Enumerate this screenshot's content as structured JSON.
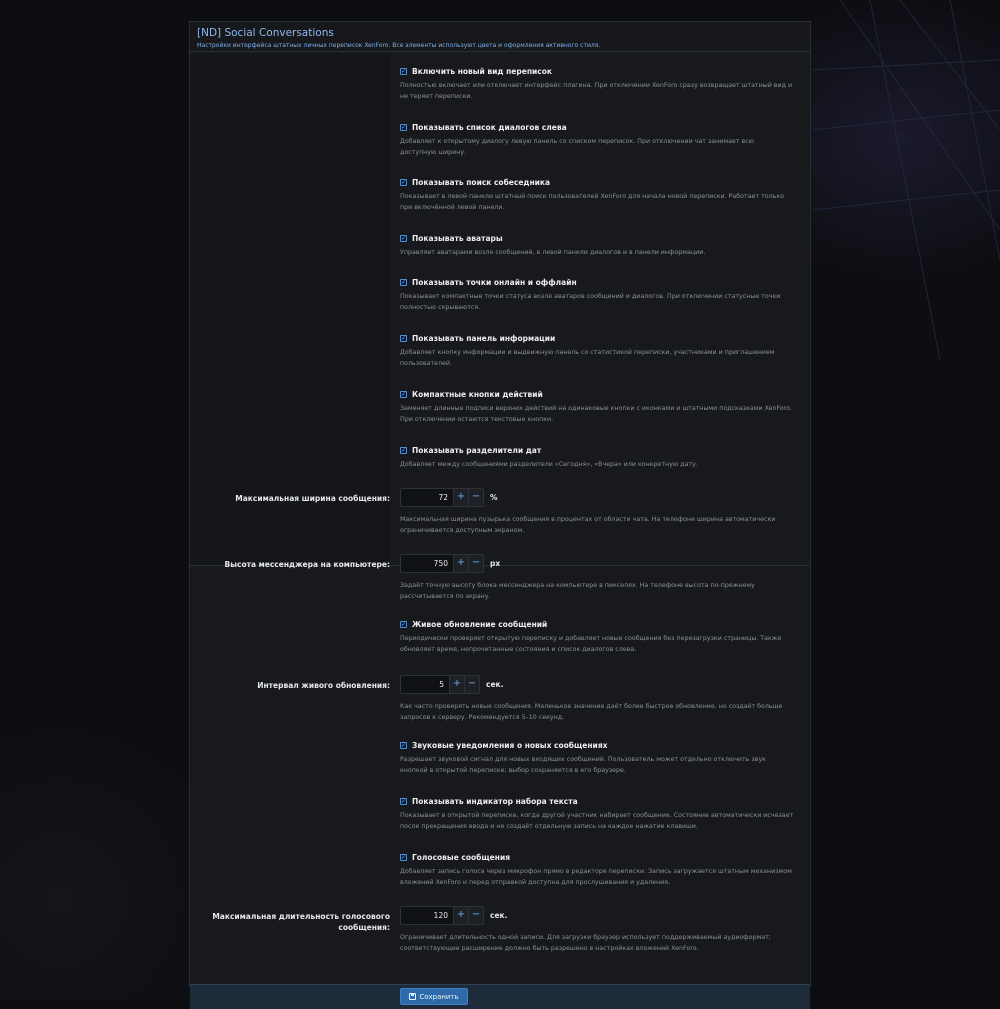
{
  "panel": {
    "title": "[ND] Social Conversations",
    "description": "Настройки интерфейса штатных личных переписок XenForo. Все элементы используют цвета и оформления активного стиля."
  },
  "options": [
    {
      "label": "Включить новый вид переписок",
      "checked": true,
      "help": [
        "Полностью включает или отключает интерфейс плагина. При отключении XenForo сразу возвращает штатный вид и",
        "не теряет переписки."
      ]
    },
    {
      "label": "Показывать список диалогов слева",
      "checked": true,
      "help": [
        "Добавляет к открытому диалогу левую панель со списком переписок. При отключении чат занимает всю",
        "доступную ширину."
      ]
    },
    {
      "label": "Показывать поиск собеседника",
      "checked": true,
      "help": [
        "Показывает в левой панели штатный поиск пользователей XenForo для начала новой переписки. Работает только",
        "при включённой левой панели."
      ]
    },
    {
      "label": "Показывать аватары",
      "checked": true,
      "help": [
        "Управляет аватарами возле сообщений, в левой панели диалогов и в панели информации."
      ]
    },
    {
      "label": "Показывать точки онлайн и оффлайн",
      "checked": true,
      "help": [
        "Показывает компактные точки статуса возле аватаров сообщений и диалогов. При отключении статусные точки",
        "полностью скрываются."
      ]
    },
    {
      "label": "Показывать панель информации",
      "checked": true,
      "help": [
        "Добавляет кнопку информации и выдвижную панель со статистикой переписки, участниками и приглашением",
        "пользователей."
      ]
    },
    {
      "label": "Компактные кнопки действий",
      "checked": true,
      "help": [
        "Заменяет длинные подписи верхних действий на одинаковые кнопки с иконками и штатными подсказками XenForo.",
        "При отключении остаются текстовые кнопки."
      ]
    },
    {
      "label": "Показывать разделители дат",
      "checked": true,
      "help": [
        "Добавляет между сообщениями разделители «Сегодня», «Вчера» или конкретную дату."
      ]
    }
  ],
  "max_width": {
    "label": "Максимальная ширина сообщения:",
    "value": "72",
    "unit": "%",
    "help": [
      "Максимальная ширина пузырька сообщения в процентах от области чата. На телефоне ширина автоматически",
      "ограничивается доступным экраном."
    ]
  },
  "desktop_height": {
    "label": "Высота мессенджера на компьютере:",
    "value": "750",
    "unit": "px",
    "help": [
      "Задаёт точную высоту блока мессенджера на компьютере в пикселях. На телефоне высота по-прежнему",
      "рассчитывается по экрану."
    ]
  },
  "live_update": {
    "label": "Живое обновление сообщений",
    "checked": true,
    "help": [
      "Периодически проверяет открытую переписку и добавляет новые сообщения без перезагрузки страницы. Также",
      "обновляет время, непрочитанные состояния и список диалогов слева."
    ]
  },
  "live_interval": {
    "label": "Интервал живого обновления:",
    "value": "5",
    "unit": "сек.",
    "help": [
      "Как часто проверять новые сообщения. Маленькое значение даёт более быстрое обновление, но создаёт больше",
      "запросов к серверу. Рекомендуется 5–10 секунд."
    ]
  },
  "sound_notify": {
    "label": "Звуковые уведомления о новых сообщениях",
    "checked": true,
    "help": [
      "Разрешает звуковой сигнал для новых входящих сообщений. Пользователь может отдельно отключить звук",
      "кнопкой в открытой переписке; выбор сохраняется в его браузере."
    ]
  },
  "typing_indicator": {
    "label": "Показывать индикатор набора текста",
    "checked": true,
    "help": [
      "Показывает в открытой переписке, когда другой участник набирает сообщение. Состояние автоматически исчезает",
      "после прекращения ввода и не создаёт отдельную запись на каждое нажатие клавиши."
    ]
  },
  "voice_messages": {
    "label": "Голосовые сообщения",
    "checked": true,
    "help": [
      "Добавляет запись голоса через микрофон прямо в редакторе переписки. Запись загружается штатным механизмом",
      "вложений XenForo и перед отправкой доступна для прослушивания и удаления."
    ]
  },
  "voice_duration": {
    "label_line1": "Максимальная длительность голосового",
    "label_line2": "сообщения:",
    "value": "120",
    "unit": "сек.",
    "help": [
      "Ограничивает длительность одной записи. Для загрузки браузер использует поддерживаемый аудиоформат;",
      "соответствующее расширение должно быть разрешено в настройках вложений XenForo."
    ]
  },
  "spinner": {
    "plus": "+",
    "minus": "−"
  },
  "footer": {
    "save_label": "Сохранить",
    "save_icon": "save-icon"
  },
  "check_glyph": "✓"
}
